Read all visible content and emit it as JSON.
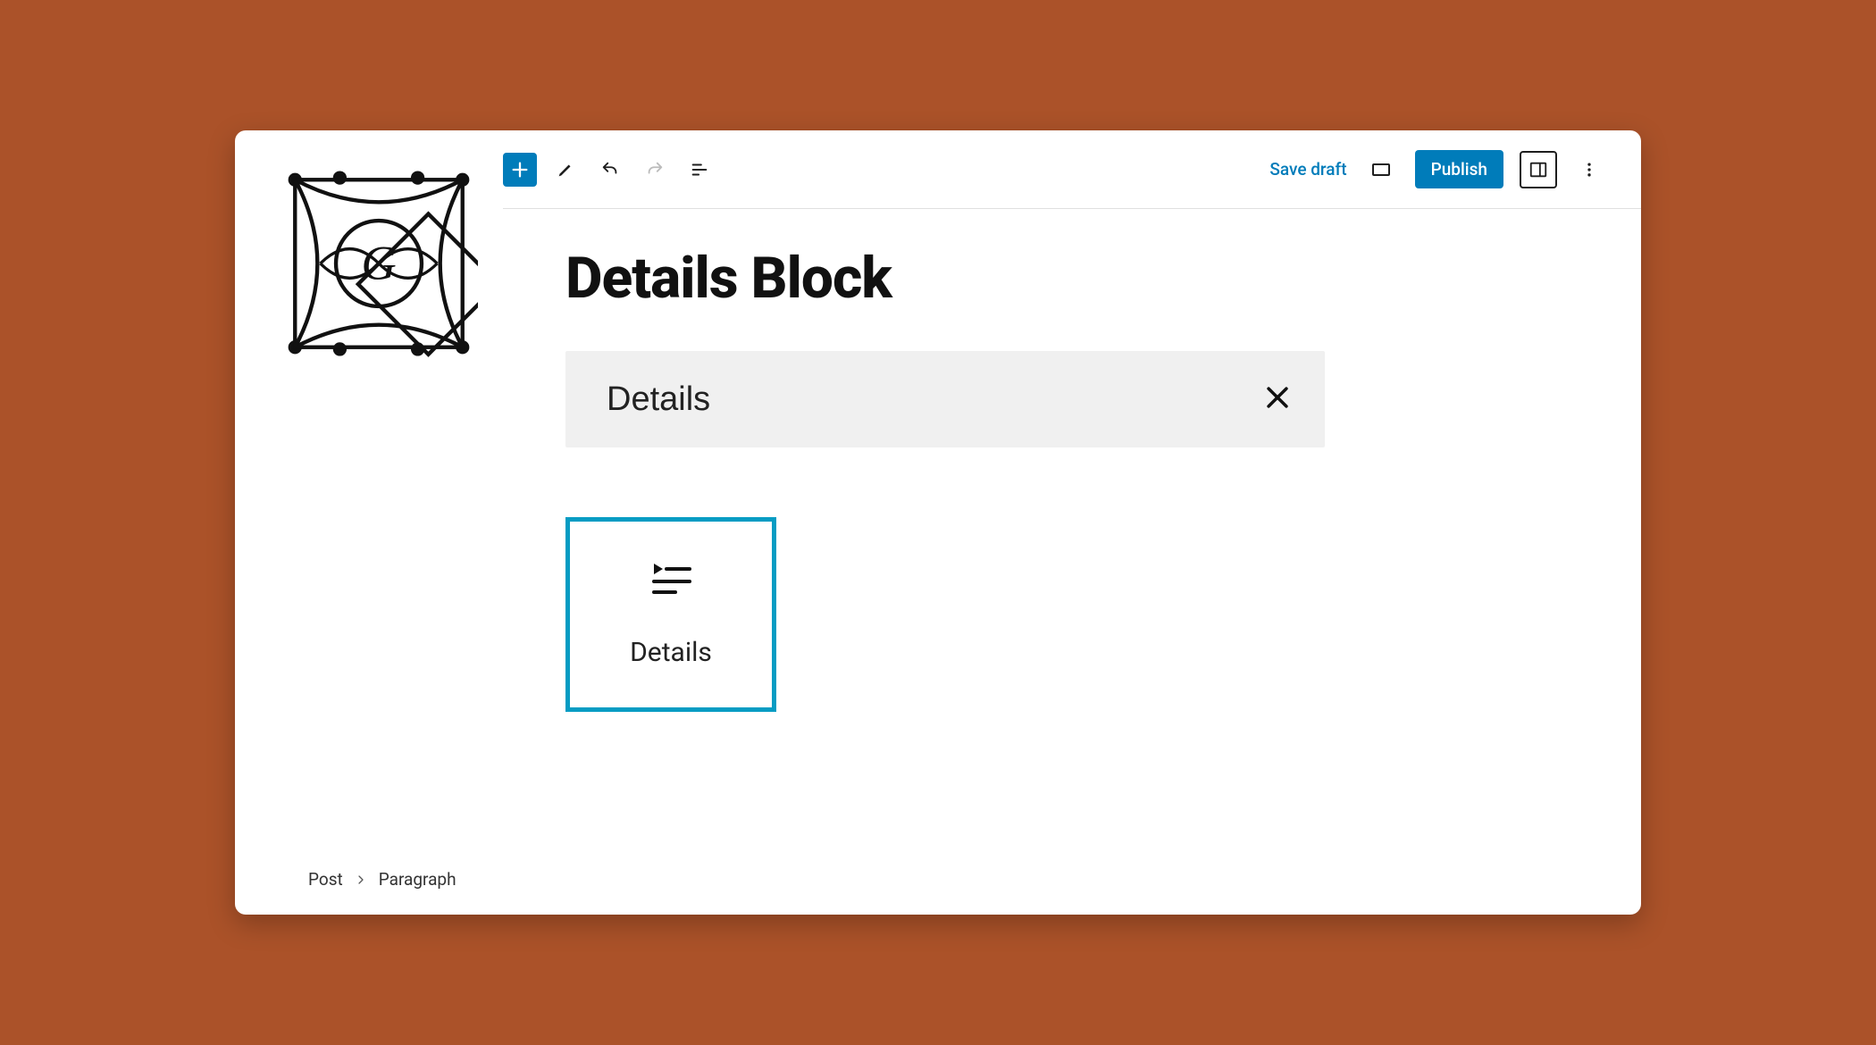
{
  "toolbar": {
    "save_draft": "Save draft",
    "publish": "Publish"
  },
  "page": {
    "title": "Details Block"
  },
  "inserter": {
    "search_value": "Details",
    "block_label": "Details"
  },
  "breadcrumb": {
    "root": "Post",
    "current": "Paragraph"
  }
}
